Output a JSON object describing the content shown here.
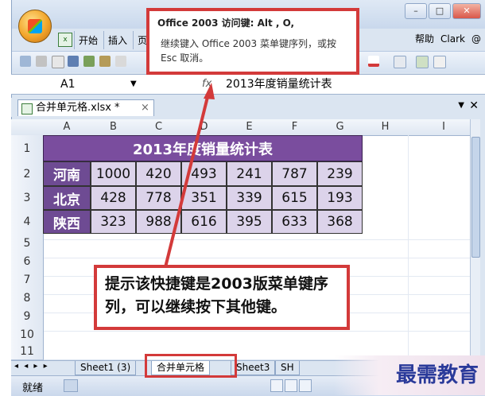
{
  "ribbon": {
    "tabs": [
      "开始",
      "插入",
      "页"
    ],
    "right_items": [
      "帮助",
      "Clark"
    ],
    "help_label": "@",
    "qa_icon": "x"
  },
  "window_controls": [
    "–",
    "□",
    "✕"
  ],
  "formula_bar": {
    "name_box": "A1",
    "fx": "fx",
    "formula": "2013年度销量统计表"
  },
  "document_tab": {
    "label": "合并单元格.xlsx *",
    "close": "×"
  },
  "columns": [
    "A",
    "B",
    "C",
    "D",
    "E",
    "F",
    "G",
    "H",
    "I"
  ],
  "rows": [
    "1",
    "2",
    "3",
    "4",
    "5",
    "6",
    "7",
    "8",
    "9",
    "10",
    "11"
  ],
  "sheet_title": "2013年度销量统计表",
  "table_rows": [
    {
      "region": "河南",
      "values": [
        "1000",
        "420",
        "493",
        "241",
        "787",
        "239"
      ]
    },
    {
      "region": "北京",
      "values": [
        "428",
        "778",
        "351",
        "339",
        "615",
        "193"
      ]
    },
    {
      "region": "陕西",
      "values": [
        "323",
        "988",
        "616",
        "395",
        "633",
        "368"
      ]
    }
  ],
  "sheet_tabs": [
    "Sheet1 (3)",
    "合并单元格",
    "Sheet3",
    "SH"
  ],
  "sheet_nav": "◂ ◂ ▸ ▸",
  "status": {
    "ready": "就绪"
  },
  "tooltip": {
    "title": "Office 2003 访问键: Alt , O,",
    "body": "继续键入 Office 2003 菜单键序列，或按 Esc 取消。"
  },
  "callout": {
    "text": "提示该快捷键是2003版菜单键序列，可以继续按下其他键。"
  },
  "watermark": "最需教育",
  "colors": {
    "title_fill": "#7a4d9e",
    "region_fill": "#6e4b93",
    "value_fill": "#dcd3ea",
    "highlight": "#d33a3a"
  }
}
